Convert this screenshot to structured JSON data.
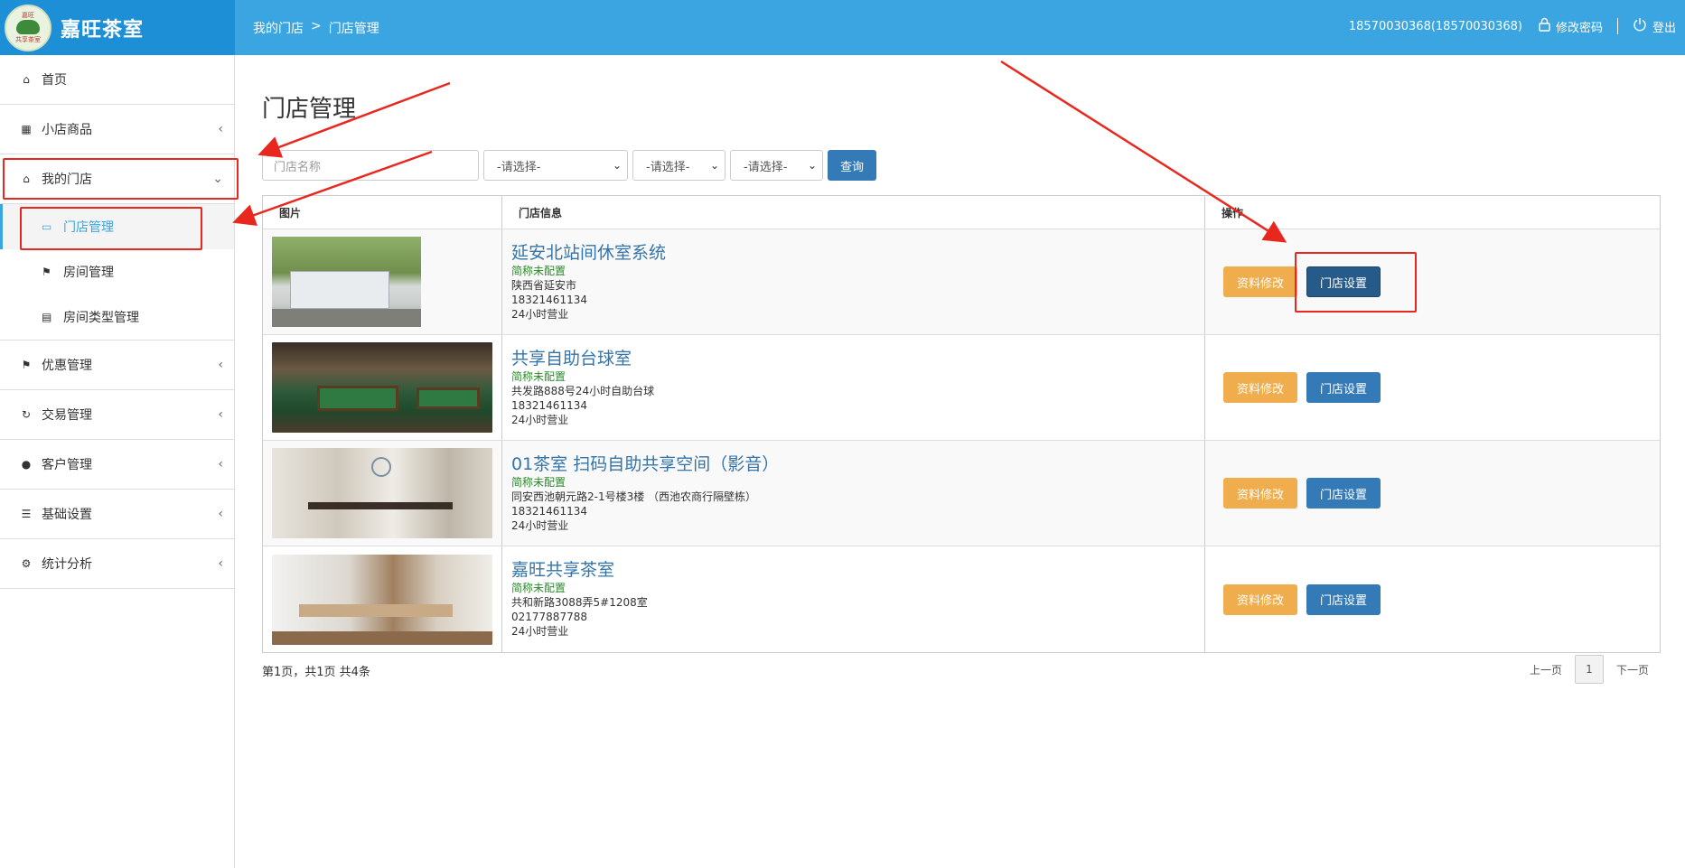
{
  "header": {
    "brand_name": "嘉旺茶室",
    "logo_text_top": "嘉旺",
    "logo_text_bottom": "共享茶室",
    "breadcrumb": [
      "我的门店",
      ">",
      "门店管理"
    ],
    "user": "18570030368(18570030368)",
    "change_password": "修改密码",
    "logout": "登出"
  },
  "sidebar": {
    "items": [
      {
        "label": "首页",
        "icon": "home-icon"
      },
      {
        "label": "小店商品",
        "icon": "gift-icon"
      },
      {
        "label": "我的门店",
        "icon": "home-icon",
        "expanded": true
      },
      {
        "label": "优惠管理",
        "icon": "tags-icon"
      },
      {
        "label": "交易管理",
        "icon": "refresh-icon"
      },
      {
        "label": "客户管理",
        "icon": "user-icon"
      },
      {
        "label": "基础设置",
        "icon": "barcode-icon"
      },
      {
        "label": "统计分析",
        "icon": "gear-icon"
      }
    ],
    "subitems": [
      {
        "label": "门店管理",
        "icon": "inbox-icon",
        "active": true
      },
      {
        "label": "房间管理",
        "icon": "flag-icon"
      },
      {
        "label": "房间类型管理",
        "icon": "list-icon"
      }
    ]
  },
  "main": {
    "title": "门店管理",
    "filters": {
      "name_placeholder": "门店名称",
      "select1": "-请选择-",
      "select2": "-请选择-",
      "select3": "-请选择-",
      "query": "查询"
    },
    "columns": [
      "图片",
      "门店信息",
      "操作"
    ],
    "stores": [
      {
        "name": "延安北站间休室系统",
        "short": "简称未配置",
        "address": "陕西省延安市",
        "phone": "18321461134",
        "hours": "24小时营业"
      },
      {
        "name": "共享自助台球室",
        "short": "简称未配置",
        "address": "共发路888号24小时自助台球",
        "phone": "18321461134",
        "hours": "24小时营业"
      },
      {
        "name": "01茶室 扫码自助共享空间（影音）",
        "short": "简称未配置",
        "address": "同安西池朝元路2-1号楼3楼 （西池农商行隔壁栋）",
        "phone": "18321461134",
        "hours": "24小时营业"
      },
      {
        "name": "嘉旺共享茶室",
        "short": "简称未配置",
        "address": "共和新路3088弄5#1208室",
        "phone": "02177887788",
        "hours": "24小时营业"
      }
    ],
    "edit_label": "资料修改",
    "settings_label": "门店设置",
    "page_info": "第1页，共1页 共4条",
    "pager": {
      "prev": "上一页",
      "current": "1",
      "next": "下一页"
    }
  },
  "colors": {
    "header": "#3aa5e0",
    "brand": "#1d8fd6",
    "annotation": "#e8281e"
  }
}
